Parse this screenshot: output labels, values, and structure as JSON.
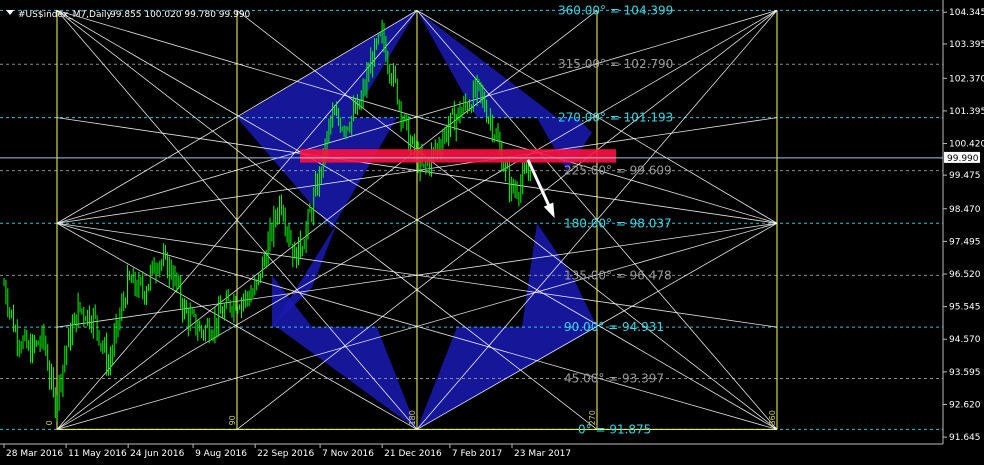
{
  "header": {
    "symbol": "#US$index_M7,Daily",
    "ohlc": "99.855 100.020 99.780 99.990"
  },
  "colors": {
    "background": "#000000",
    "candles": "#00ff00",
    "levels_cyan": "#39d7e6",
    "levels_gray": "#9a9a9a",
    "rays": "#ffffff",
    "verticals": "#ffff66",
    "triangles": "#1a1ab4",
    "zone": "#ff1040",
    "arrow": "#ffffff"
  },
  "chart_data": {
    "type": "candlestick",
    "ylim": [
      91.2,
      104.65
    ],
    "current_price": "99.990",
    "y_ticks": [
      "104.345",
      "103.395",
      "102.370",
      "101.395",
      "100.420",
      "99.475",
      "98.470",
      "97.495",
      "96.520",
      "95.545",
      "94.570",
      "93.595",
      "92.620",
      "91.645"
    ],
    "x_ticks": [
      "28 Mar 2016",
      "11 May 2016",
      "24 Jun 2016",
      "9 Aug 2016",
      "22 Sep 2016",
      "7 Nov 2016",
      "21 Dec 2016",
      "7 Feb 2017",
      "23 Mar 2017"
    ],
    "gann_levels": [
      {
        "label": "360.00° = 104.399",
        "price": 104.399,
        "color": "cyan"
      },
      {
        "label": "315.00° = 102.790",
        "price": 102.79,
        "color": "gray"
      },
      {
        "label": "270.00° = 101.193",
        "price": 101.193,
        "color": "cyan"
      },
      {
        "label": "225.00° = 99.609",
        "price": 99.609,
        "color": "gray"
      },
      {
        "label": "180.00° = 98.037",
        "price": 98.037,
        "color": "cyan"
      },
      {
        "label": "135.00° = 96.478",
        "price": 96.478,
        "color": "gray"
      },
      {
        "label": "90.00° = 94.931",
        "price": 94.931,
        "color": "cyan"
      },
      {
        "label": "45.00° = 93.397",
        "price": 93.397,
        "color": "gray"
      },
      {
        "label": "0° = 91.875",
        "price": 91.875,
        "color": "cyan"
      }
    ],
    "vertical_labels": [
      "0",
      "90",
      "180",
      "270",
      "360"
    ],
    "resistance_zone": [
      99.85,
      100.25
    ],
    "price_path": [
      [
        "28 Mar 2016",
        96.2
      ],
      [
        "05 Apr 2016",
        94.8
      ],
      [
        "15 Apr 2016",
        94.2
      ],
      [
        "25 Apr 2016",
        94.6
      ],
      [
        "03 May 2016",
        92.6
      ],
      [
        "11 May 2016",
        94.3
      ],
      [
        "20 May 2016",
        95.5
      ],
      [
        "31 May 2016",
        95.2
      ],
      [
        "10 Jun 2016",
        93.8
      ],
      [
        "24 Jun 2016",
        96.3
      ],
      [
        "05 Jul 2016",
        96.0
      ],
      [
        "15 Jul 2016",
        97.0
      ],
      [
        "25 Jul 2016",
        96.6
      ],
      [
        "04 Aug 2016",
        95.3
      ],
      [
        "15 Aug 2016",
        94.8
      ],
      [
        "25 Aug 2016",
        95.1
      ],
      [
        "05 Sep 2016",
        95.7
      ],
      [
        "15 Sep 2016",
        95.8
      ],
      [
        "22 Sep 2016",
        96.0
      ],
      [
        "30 Sep 2016",
        97.2
      ],
      [
        "10 Oct 2016",
        98.8
      ],
      [
        "20 Oct 2016",
        97.0
      ],
      [
        "28 Oct 2016",
        97.8
      ],
      [
        "07 Nov 2016",
        99.5
      ],
      [
        "15 Nov 2016",
        101.2
      ],
      [
        "25 Nov 2016",
        101.0
      ],
      [
        "05 Dec 2016",
        101.5
      ],
      [
        "14 Dec 2016",
        103.0
      ],
      [
        "21 Dec 2016",
        103.6
      ],
      [
        "30 Dec 2016",
        102.2
      ],
      [
        "09 Jan 2017",
        100.5
      ],
      [
        "19 Jan 2017",
        99.6
      ],
      [
        "30 Jan 2017",
        100.4
      ],
      [
        "07 Feb 2017",
        101.0
      ],
      [
        "17 Feb 2017",
        101.5
      ],
      [
        "27 Feb 2017",
        102.0
      ],
      [
        "09 Mar 2017",
        101.0
      ],
      [
        "17 Mar 2017",
        99.8
      ],
      [
        "23 Mar 2017",
        99.0
      ],
      [
        "31 Mar 2017",
        99.3
      ],
      [
        "06 Apr 2017",
        99.9
      ]
    ]
  }
}
